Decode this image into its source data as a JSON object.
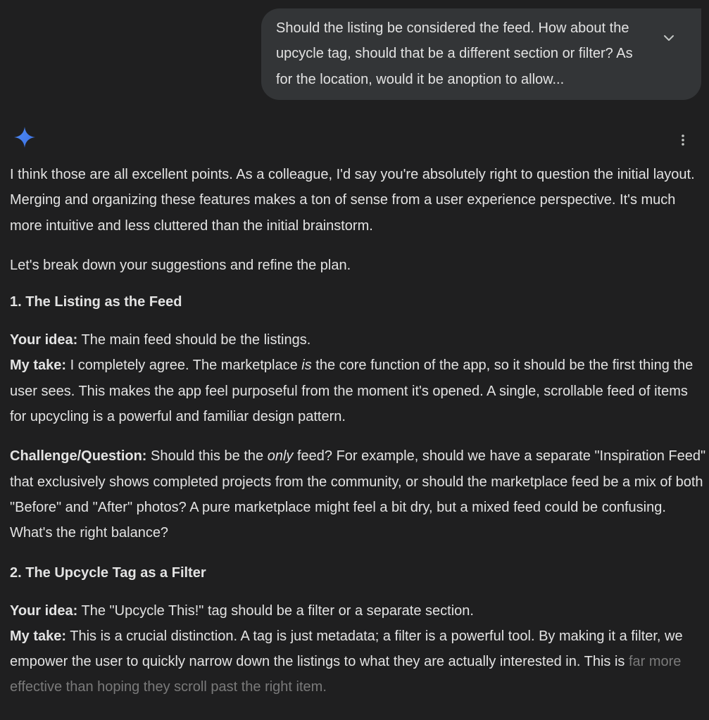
{
  "user_message": {
    "text": "Should the listing be considered the feed. How about the upcycle tag, should that be a different section or filter? As for the location, would it be anoption to allow..."
  },
  "icons": {
    "expand": "chevron-down-icon",
    "assistant": "gemini-sparkle-icon",
    "more": "more-vert-icon"
  },
  "colors": {
    "background": "#1f1f20",
    "bubble": "#333537",
    "text": "#e3e3e3",
    "sparkle": "#4e8cf5"
  },
  "response": {
    "intro": "I think those are all excellent points. As a colleague, I'd say you're absolutely right to question the initial layout. Merging and organizing these features makes a ton of sense from a user experience perspective. It's much more intuitive and less cluttered than the initial brainstorm.",
    "lead": "Let's break down your suggestions and refine the plan.",
    "section1": {
      "heading": "1. The Listing as the Feed",
      "idea_label": "Your idea:",
      "idea_text": " The main feed should be the listings.",
      "take_label": "My take:",
      "take_text_a": " I completely agree. The marketplace ",
      "take_emph": "is",
      "take_text_b": " the core function of the app, so it should be the first thing the user sees. This makes the app feel purposeful from the moment it's opened. A single, scrollable feed of items for upcycling is a powerful and familiar design pattern.",
      "challenge_label": "Challenge/Question:",
      "challenge_text_a": " Should this be the ",
      "challenge_emph": "only",
      "challenge_text_b": " feed? For example, should we have a separate \"Inspiration Feed\" that exclusively shows completed projects from the community, or should the marketplace feed be a mix of both \"Before\" and \"After\" photos? A pure marketplace might feel a bit dry, but a mixed feed could be confusing. What's the right balance?"
    },
    "section2": {
      "heading": "2. The Upcycle Tag as a Filter",
      "idea_label": "Your idea:",
      "idea_text": " The \"Upcycle This!\" tag should be a filter or a separate section.",
      "take_label": "My take:",
      "take_text": " This is a crucial distinction. A tag is just metadata; a filter is a powerful tool. By making it a filter, we empower the user to quickly narrow down the listings to what they are actually interested in. This is ",
      "take_fade": "far more effective than hoping they scroll past the right item."
    }
  }
}
